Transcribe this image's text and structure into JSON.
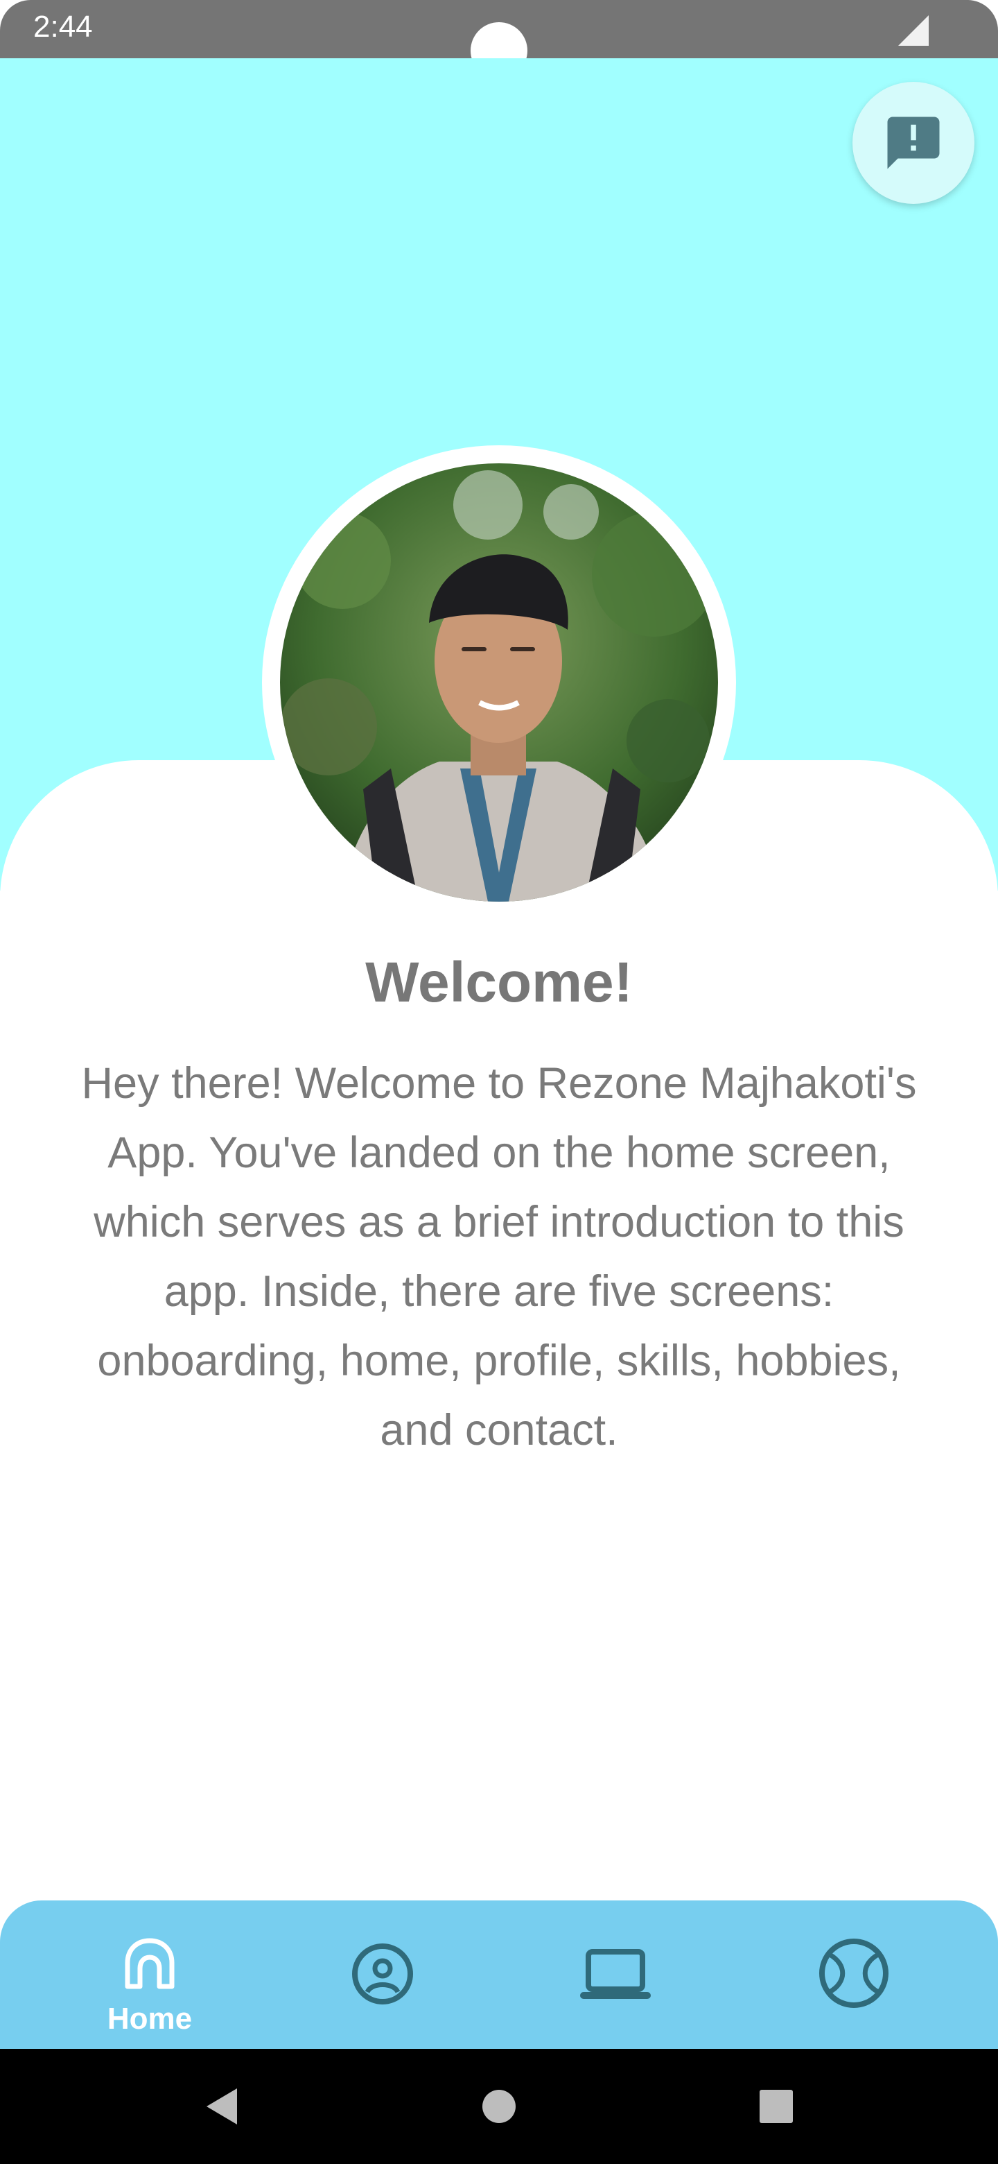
{
  "status_bar": {
    "time": "2:44",
    "signal_icon": "signal-icon"
  },
  "feedback": {
    "icon": "feedback-icon"
  },
  "avatar": {
    "icon": "profile-photo"
  },
  "main": {
    "title": "Welcome!",
    "intro": "Hey there! Welcome to Rezone Majhakoti's App. You've landed on the home screen, which serves as a brief introduction to this app. Inside, there are five screens: onboarding, home, profile, skills, hobbies, and contact."
  },
  "bottom_nav": {
    "items": [
      {
        "label": "Home",
        "icon": "home-icon",
        "active": true
      },
      {
        "label": "",
        "icon": "profile-icon",
        "active": false
      },
      {
        "label": "",
        "icon": "laptop-icon",
        "active": false
      },
      {
        "label": "",
        "icon": "ball-icon",
        "active": false
      }
    ]
  },
  "system_nav": {
    "back_icon": "back-icon",
    "home_icon": "home-circle-icon",
    "recents_icon": "recents-icon"
  },
  "colors": {
    "hero_background": "#a1ffff",
    "nav_background": "#77ceef",
    "icon_color": "#2f6a7a",
    "text_color": "#777777"
  }
}
